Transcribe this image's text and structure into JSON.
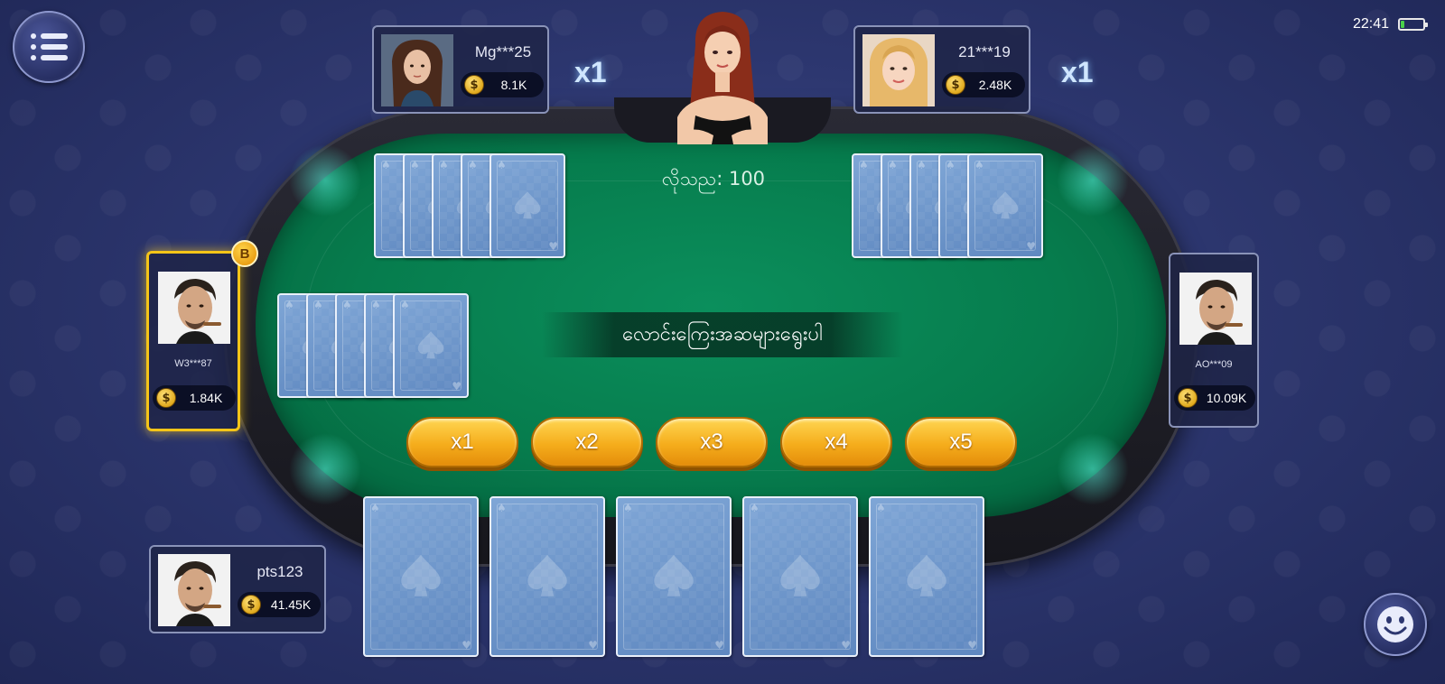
{
  "status": {
    "time": "22:41",
    "battery_level": 0.15
  },
  "menu": {
    "icon": "menu-list-icon"
  },
  "table": {
    "dealer_label": "လိုသည: 100",
    "prompt": "လောင်းကြေးအဆများရွေးပါ",
    "multiplier_buttons": [
      "x1",
      "x2",
      "x3",
      "x4",
      "x5"
    ]
  },
  "players": {
    "top_left": {
      "name": "Mg***25",
      "chips": "8.1K",
      "multiplier": "x1"
    },
    "top_right": {
      "name": "21***19",
      "chips": "2.48K",
      "multiplier": "x1"
    },
    "left": {
      "name": "W3***87",
      "chips": "1.84K",
      "badge": "B"
    },
    "right": {
      "name": "AO***09",
      "chips": "10.09K"
    },
    "self": {
      "name": "pts123",
      "chips": "41.45K"
    }
  },
  "colors": {
    "felt": "#067c4d",
    "accent_gold": "#f5c518",
    "button_gold": "#f5ad1c",
    "background": "#2d3770"
  }
}
